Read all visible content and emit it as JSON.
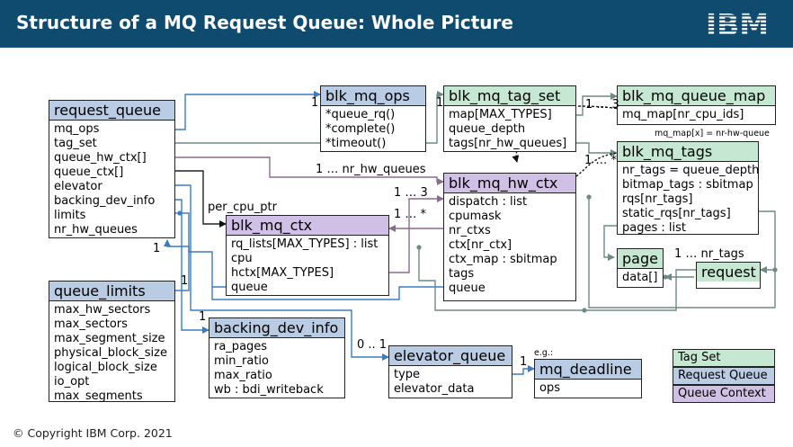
{
  "page": {
    "title": "Structure of a MQ Request Queue: Whole Picture",
    "logo_text": "IBM",
    "footer": "© Copyright IBM Corp. 2021"
  },
  "colors": {
    "header_bg": "#0f4a6f",
    "tag_set": "#c6e8d2",
    "request_queue": "#b9cce4",
    "queue_context": "#d0c0e6",
    "blue_link": "#3a7cc3",
    "grey_link": "#6f8a85"
  },
  "boxes": {
    "request_queue": {
      "title": "request_queue",
      "fields": [
        "mq_ops",
        "tag_set",
        "queue_hw_ctx[]",
        "queue_ctx[]",
        "elevator",
        "backing_dev_info",
        "limits",
        "nr_hw_queues"
      ]
    },
    "queue_limits": {
      "title": "queue_limits",
      "fields": [
        "max_hw_sectors",
        "max_sectors",
        "max_segment_size",
        "physical_block_size",
        "logical_block_size",
        "io_opt",
        "max_segments"
      ]
    },
    "blk_mq_ops": {
      "title": "blk_mq_ops",
      "fields": [
        "*queue_rq()",
        "*complete()",
        "*timeout()"
      ]
    },
    "blk_mq_tag_set": {
      "title": "blk_mq_tag_set",
      "fields": [
        "map[MAX_TYPES]",
        "queue_depth",
        "tags[nr_hw_queues]"
      ]
    },
    "blk_mq_queue_map": {
      "title": "blk_mq_queue_map",
      "fields": [
        "mq_map[nr_cpu_ids]"
      ]
    },
    "blk_mq_tags": {
      "title": "blk_mq_tags",
      "fields": [
        "nr_tags = queue_depth",
        "bitmap_tags : sbitmap",
        "rqs[nr_tags]",
        "static_rqs[nr_tags]",
        "pages : list"
      ]
    },
    "blk_mq_hw_ctx": {
      "title": "blk_mq_hw_ctx",
      "fields": [
        "dispatch : list",
        "cpumask",
        "nr_ctxs",
        "ctx[nr_ctx]",
        "ctx_map : sbitmap",
        "tags",
        "queue"
      ]
    },
    "blk_mq_ctx": {
      "title": "blk_mq_ctx",
      "fields": [
        "rq_lists[MAX_TYPES] : list",
        "cpu",
        "hctx[MAX_TYPES]",
        "queue"
      ]
    },
    "page": {
      "title": "page",
      "fields": [
        "data[]"
      ]
    },
    "request": {
      "title": "request"
    },
    "backing_dev_info": {
      "title": "backing_dev_info",
      "fields": [
        "ra_pages",
        "min_ratio",
        "max_ratio",
        "wb : bdi_writeback"
      ]
    },
    "elevator_queue": {
      "title": "elevator_queue",
      "fields": [
        "type",
        "elevator_data"
      ]
    },
    "mq_deadline": {
      "title": "mq_deadline",
      "fields": [
        "ops"
      ]
    }
  },
  "labels": {
    "ops_mult": "1",
    "tagset_mult": "1",
    "queue_map_mult": "1 … 3",
    "tags_mult": "1 … *",
    "hw_queues_mult": "1 … nr_hw_queues",
    "ctx_hw_mult": "1 … 3",
    "hw_ctx_mult": "1 … *",
    "per_cpu_ptr": "per_cpu_ptr",
    "limits_mult_rq": "1",
    "limits_mult": "1",
    "bdi_mult": "1",
    "elevator_mult": "0 .. 1",
    "deadline_mult": "1",
    "eg": "e.g.:",
    "nr_tags_mult": "1 … nr_tags",
    "mq_map_note": "mq_map[x] = nr-hw-queue"
  },
  "legend": {
    "tag_set": "Tag Set",
    "request_queue": "Request Queue",
    "queue_context": "Queue Context"
  }
}
